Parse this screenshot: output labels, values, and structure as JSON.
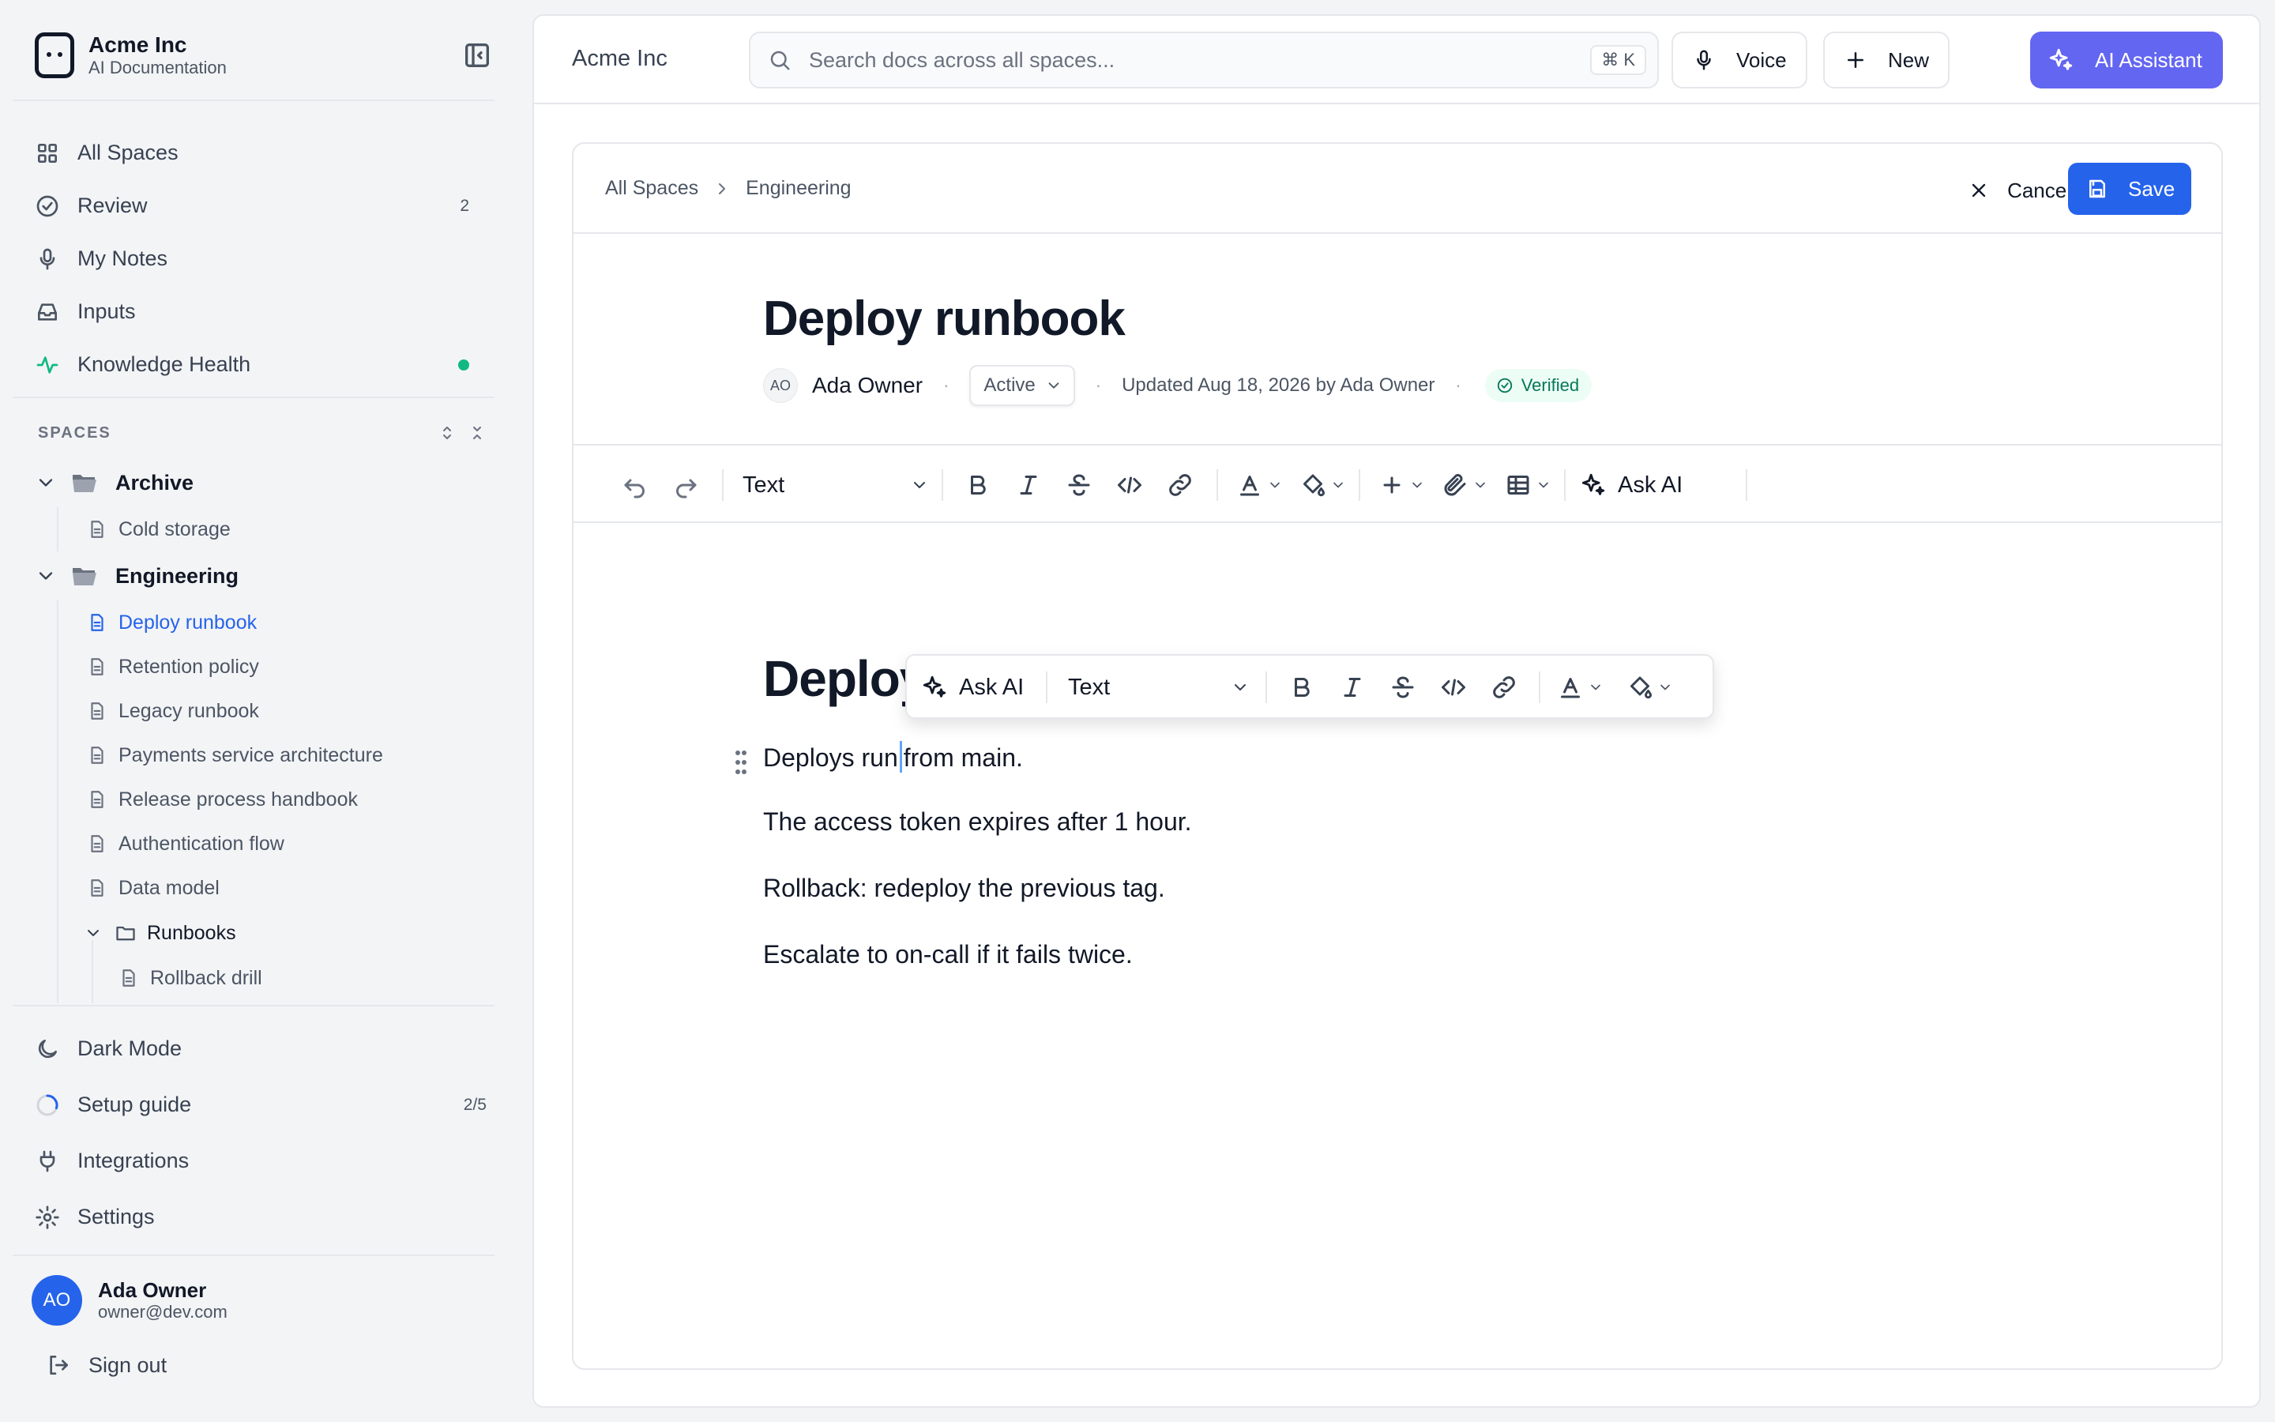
{
  "brand": {
    "name": "Acme Inc",
    "subtitle": "AI Documentation"
  },
  "nav": [
    {
      "label": "All Spaces",
      "icon": "grid-icon"
    },
    {
      "label": "Review",
      "icon": "check-circle-icon",
      "badge": "2"
    },
    {
      "label": "My Notes",
      "icon": "mic-icon"
    },
    {
      "label": "Inputs",
      "icon": "inbox-icon"
    },
    {
      "label": "Knowledge Health",
      "icon": "activity-icon",
      "status_color": "#10b981"
    }
  ],
  "spaces": {
    "label": "SPACES",
    "archive": {
      "name": "Archive",
      "docs": [
        "Cold storage"
      ]
    },
    "engineering": {
      "name": "Engineering",
      "docs": [
        "Deploy runbook",
        "Retention policy",
        "Legacy runbook",
        "Payments service architecture",
        "Release process handbook",
        "Authentication flow",
        "Data model"
      ],
      "subfolder": {
        "name": "Runbooks",
        "docs": [
          "Rollback drill"
        ]
      }
    }
  },
  "bottom_nav": {
    "dark_mode": "Dark Mode",
    "setup_guide": "Setup guide",
    "setup_progress": "2/5",
    "integrations": "Integrations",
    "settings": "Settings"
  },
  "user": {
    "initials": "AO",
    "name": "Ada Owner",
    "email": "owner@dev.com",
    "signout": "Sign out"
  },
  "topbar": {
    "workspace": "Acme Inc",
    "search_placeholder": "Search docs across all spaces...",
    "shortcut": "⌘ K",
    "voice": "Voice",
    "new": "New",
    "ai_assistant": "AI Assistant"
  },
  "colors": {
    "accent": "#2563eb",
    "ai": "#6366f1",
    "verified": "#047857"
  },
  "editor": {
    "breadcrumb": [
      "All Spaces",
      "Engineering"
    ],
    "cancel": "Cancel",
    "save": "Save",
    "title": "Deploy runbook",
    "author_initials": "AO",
    "author": "Ada Owner",
    "status": "Active",
    "updated": "Updated Aug 18, 2026 by Ada Owner",
    "verified": "Verified",
    "toolbar": {
      "block_type": "Text",
      "ask_ai": "Ask AI"
    },
    "bubble": {
      "ask_ai": "Ask AI",
      "block_type": "Text"
    },
    "content": {
      "heading": "Deploy",
      "p1_before": "Deploys run",
      "p1_after": "from main.",
      "p2": "The access token expires after 1 hour.",
      "p3": "Rollback: redeploy the previous tag.",
      "p4": "Escalate to on-call if it fails twice."
    }
  }
}
